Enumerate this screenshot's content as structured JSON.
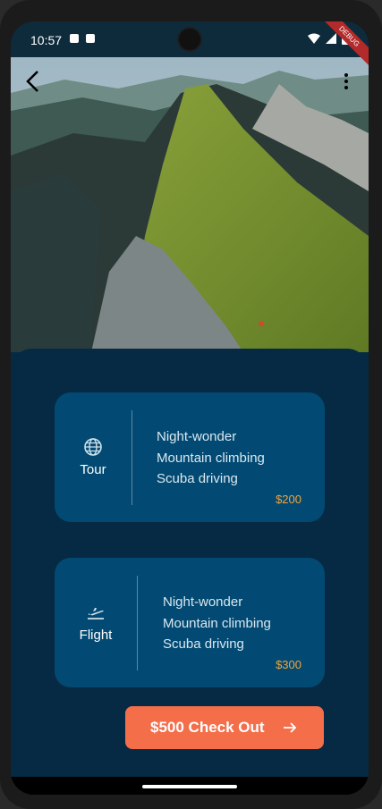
{
  "status": {
    "time": "10:57",
    "debug": "DEBUG"
  },
  "header": {
    "back_icon": "arrow-back-icon",
    "menu_icon": "more-vert-icon"
  },
  "hero": {
    "image": "mountain-ridge-photo"
  },
  "cards": [
    {
      "icon": "globe-icon",
      "title": "Tour",
      "items": [
        "Night-wonder",
        "Mountain climbing",
        "Scuba driving"
      ],
      "price": "$200"
    },
    {
      "icon": "flight-takeoff-icon",
      "title": "Flight",
      "items": [
        "Night-wonder",
        "Mountain climbing",
        "Scuba driving"
      ],
      "price": "$300"
    }
  ],
  "checkout": {
    "label": "$500 Check Out",
    "icon": "arrow-forward-icon"
  },
  "colors": {
    "background": "#062a43",
    "card": "#024a73",
    "accent": "#f46e4a",
    "price": "#f3a33a"
  }
}
